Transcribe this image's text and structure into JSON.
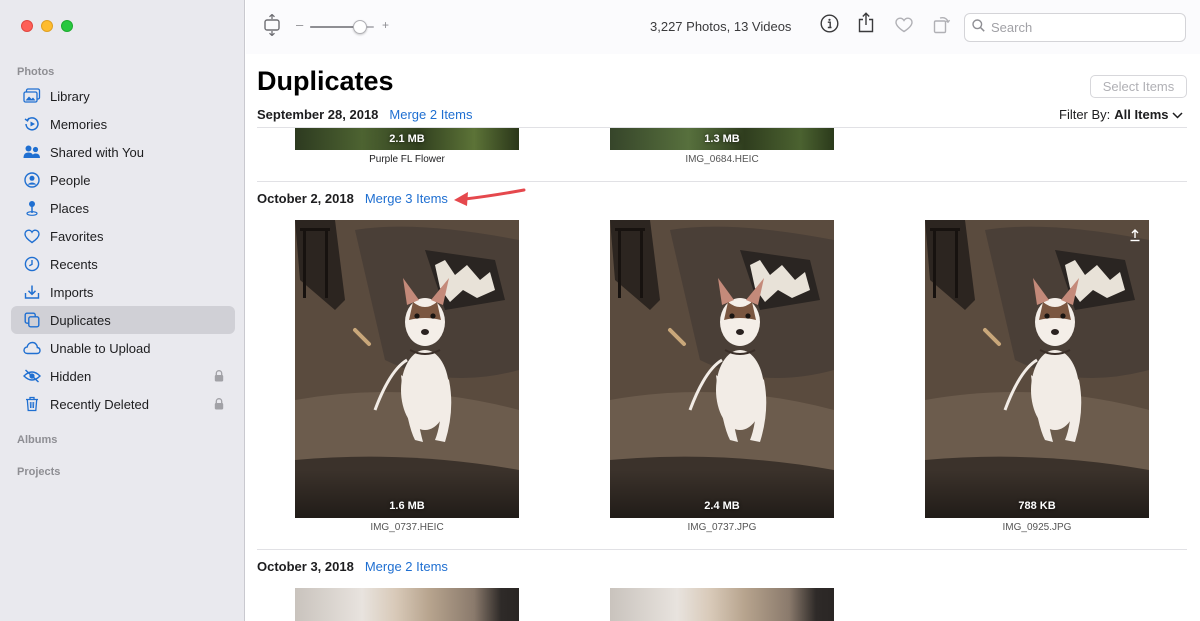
{
  "sidebar": {
    "photos_heading": "Photos",
    "albums_heading": "Albums",
    "projects_heading": "Projects",
    "items": [
      {
        "label": "Library",
        "icon": "library-icon"
      },
      {
        "label": "Memories",
        "icon": "memories-icon"
      },
      {
        "label": "Shared with You",
        "icon": "shared-icon"
      },
      {
        "label": "People",
        "icon": "people-icon"
      },
      {
        "label": "Places",
        "icon": "places-icon"
      },
      {
        "label": "Favorites",
        "icon": "heart-icon"
      },
      {
        "label": "Recents",
        "icon": "clock-icon"
      },
      {
        "label": "Imports",
        "icon": "imports-icon"
      },
      {
        "label": "Duplicates",
        "icon": "duplicates-icon",
        "active": true
      },
      {
        "label": "Unable to Upload",
        "icon": "cloud-icon"
      },
      {
        "label": "Hidden",
        "icon": "eye-slash-icon",
        "locked": true
      },
      {
        "label": "Recently Deleted",
        "icon": "trash-icon",
        "locked": true
      }
    ]
  },
  "toolbar": {
    "zoom_minus": "–",
    "zoom_plus": "+",
    "zoom_level": 0.85,
    "count": "3,227 Photos, 13 Videos",
    "search_placeholder": "Search"
  },
  "main": {
    "title": "Duplicates",
    "select_items": "Select Items",
    "filter_label": "Filter By:",
    "filter_value": "All Items",
    "groups": [
      {
        "date": "September 28, 2018",
        "merge": "Merge 2 Items",
        "items": [
          {
            "size": "2.1 MB",
            "name": "Purple FL Flower"
          },
          {
            "size": "1.3 MB",
            "name": "IMG_0684.HEIC"
          }
        ]
      },
      {
        "date": "October 2, 2018",
        "merge": "Merge 3 Items",
        "items": [
          {
            "size": "1.6 MB",
            "name": "IMG_0737.HEIC"
          },
          {
            "size": "2.4 MB",
            "name": "IMG_0737.JPG"
          },
          {
            "size": "788 KB",
            "name": "IMG_0925.JPG"
          }
        ]
      },
      {
        "date": "October 3, 2018",
        "merge": "Merge 2 Items",
        "items": []
      }
    ]
  },
  "colors": {
    "accent": "#1f6fd1",
    "sidebar_bg": "#e9e9ee",
    "active_item": "#d0d0d6",
    "annotation_arrow": "#e5484d"
  }
}
